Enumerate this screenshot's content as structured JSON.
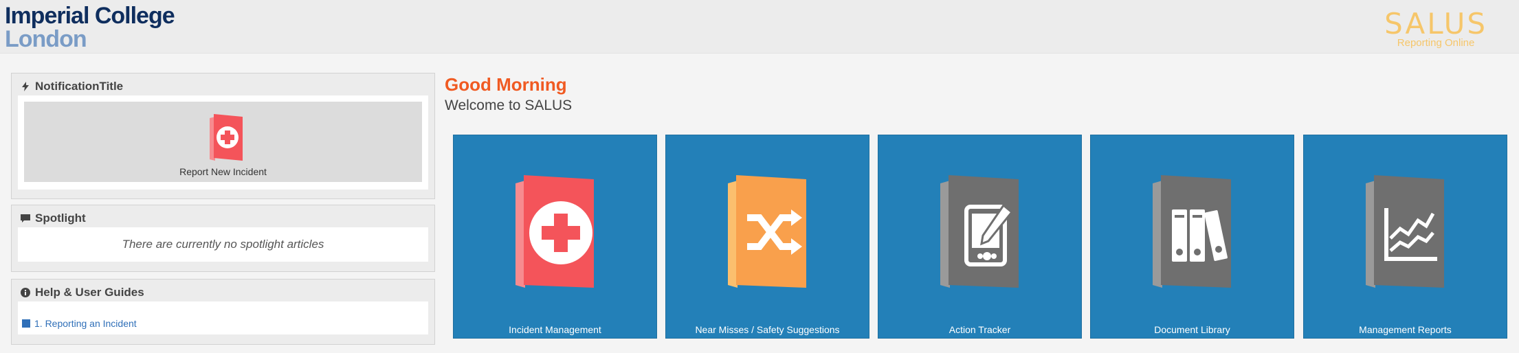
{
  "header": {
    "logo_line1": "Imperial College",
    "logo_line2": "London",
    "brand_name": "SALUS",
    "brand_tagline": "Reporting Online"
  },
  "notification": {
    "title": "NotificationTitle",
    "report_label": "Report New Incident"
  },
  "spotlight": {
    "title": "Spotlight",
    "empty_text": "There are currently no spotlight articles"
  },
  "help": {
    "title": "Help & User Guides",
    "items": [
      {
        "label": "1. Reporting an Incident"
      }
    ]
  },
  "greeting": "Good Morning",
  "welcome": "Welcome to SALUS",
  "tiles": [
    {
      "label": "Incident Management",
      "icon": "first-aid-book-icon"
    },
    {
      "label": "Near Misses / Safety Suggestions",
      "icon": "shuffle-book-icon"
    },
    {
      "label": "Action Tracker",
      "icon": "tablet-pen-icon"
    },
    {
      "label": "Document Library",
      "icon": "binders-icon"
    },
    {
      "label": "Management Reports",
      "icon": "line-chart-icon"
    }
  ],
  "colors": {
    "tile_bg": "#2380b8",
    "greeting": "#f05a22",
    "brand": "#f6c66a",
    "incident": "#f4545a",
    "near_miss": "#f9a04c",
    "neutral_icon": "#6f6f6f"
  }
}
